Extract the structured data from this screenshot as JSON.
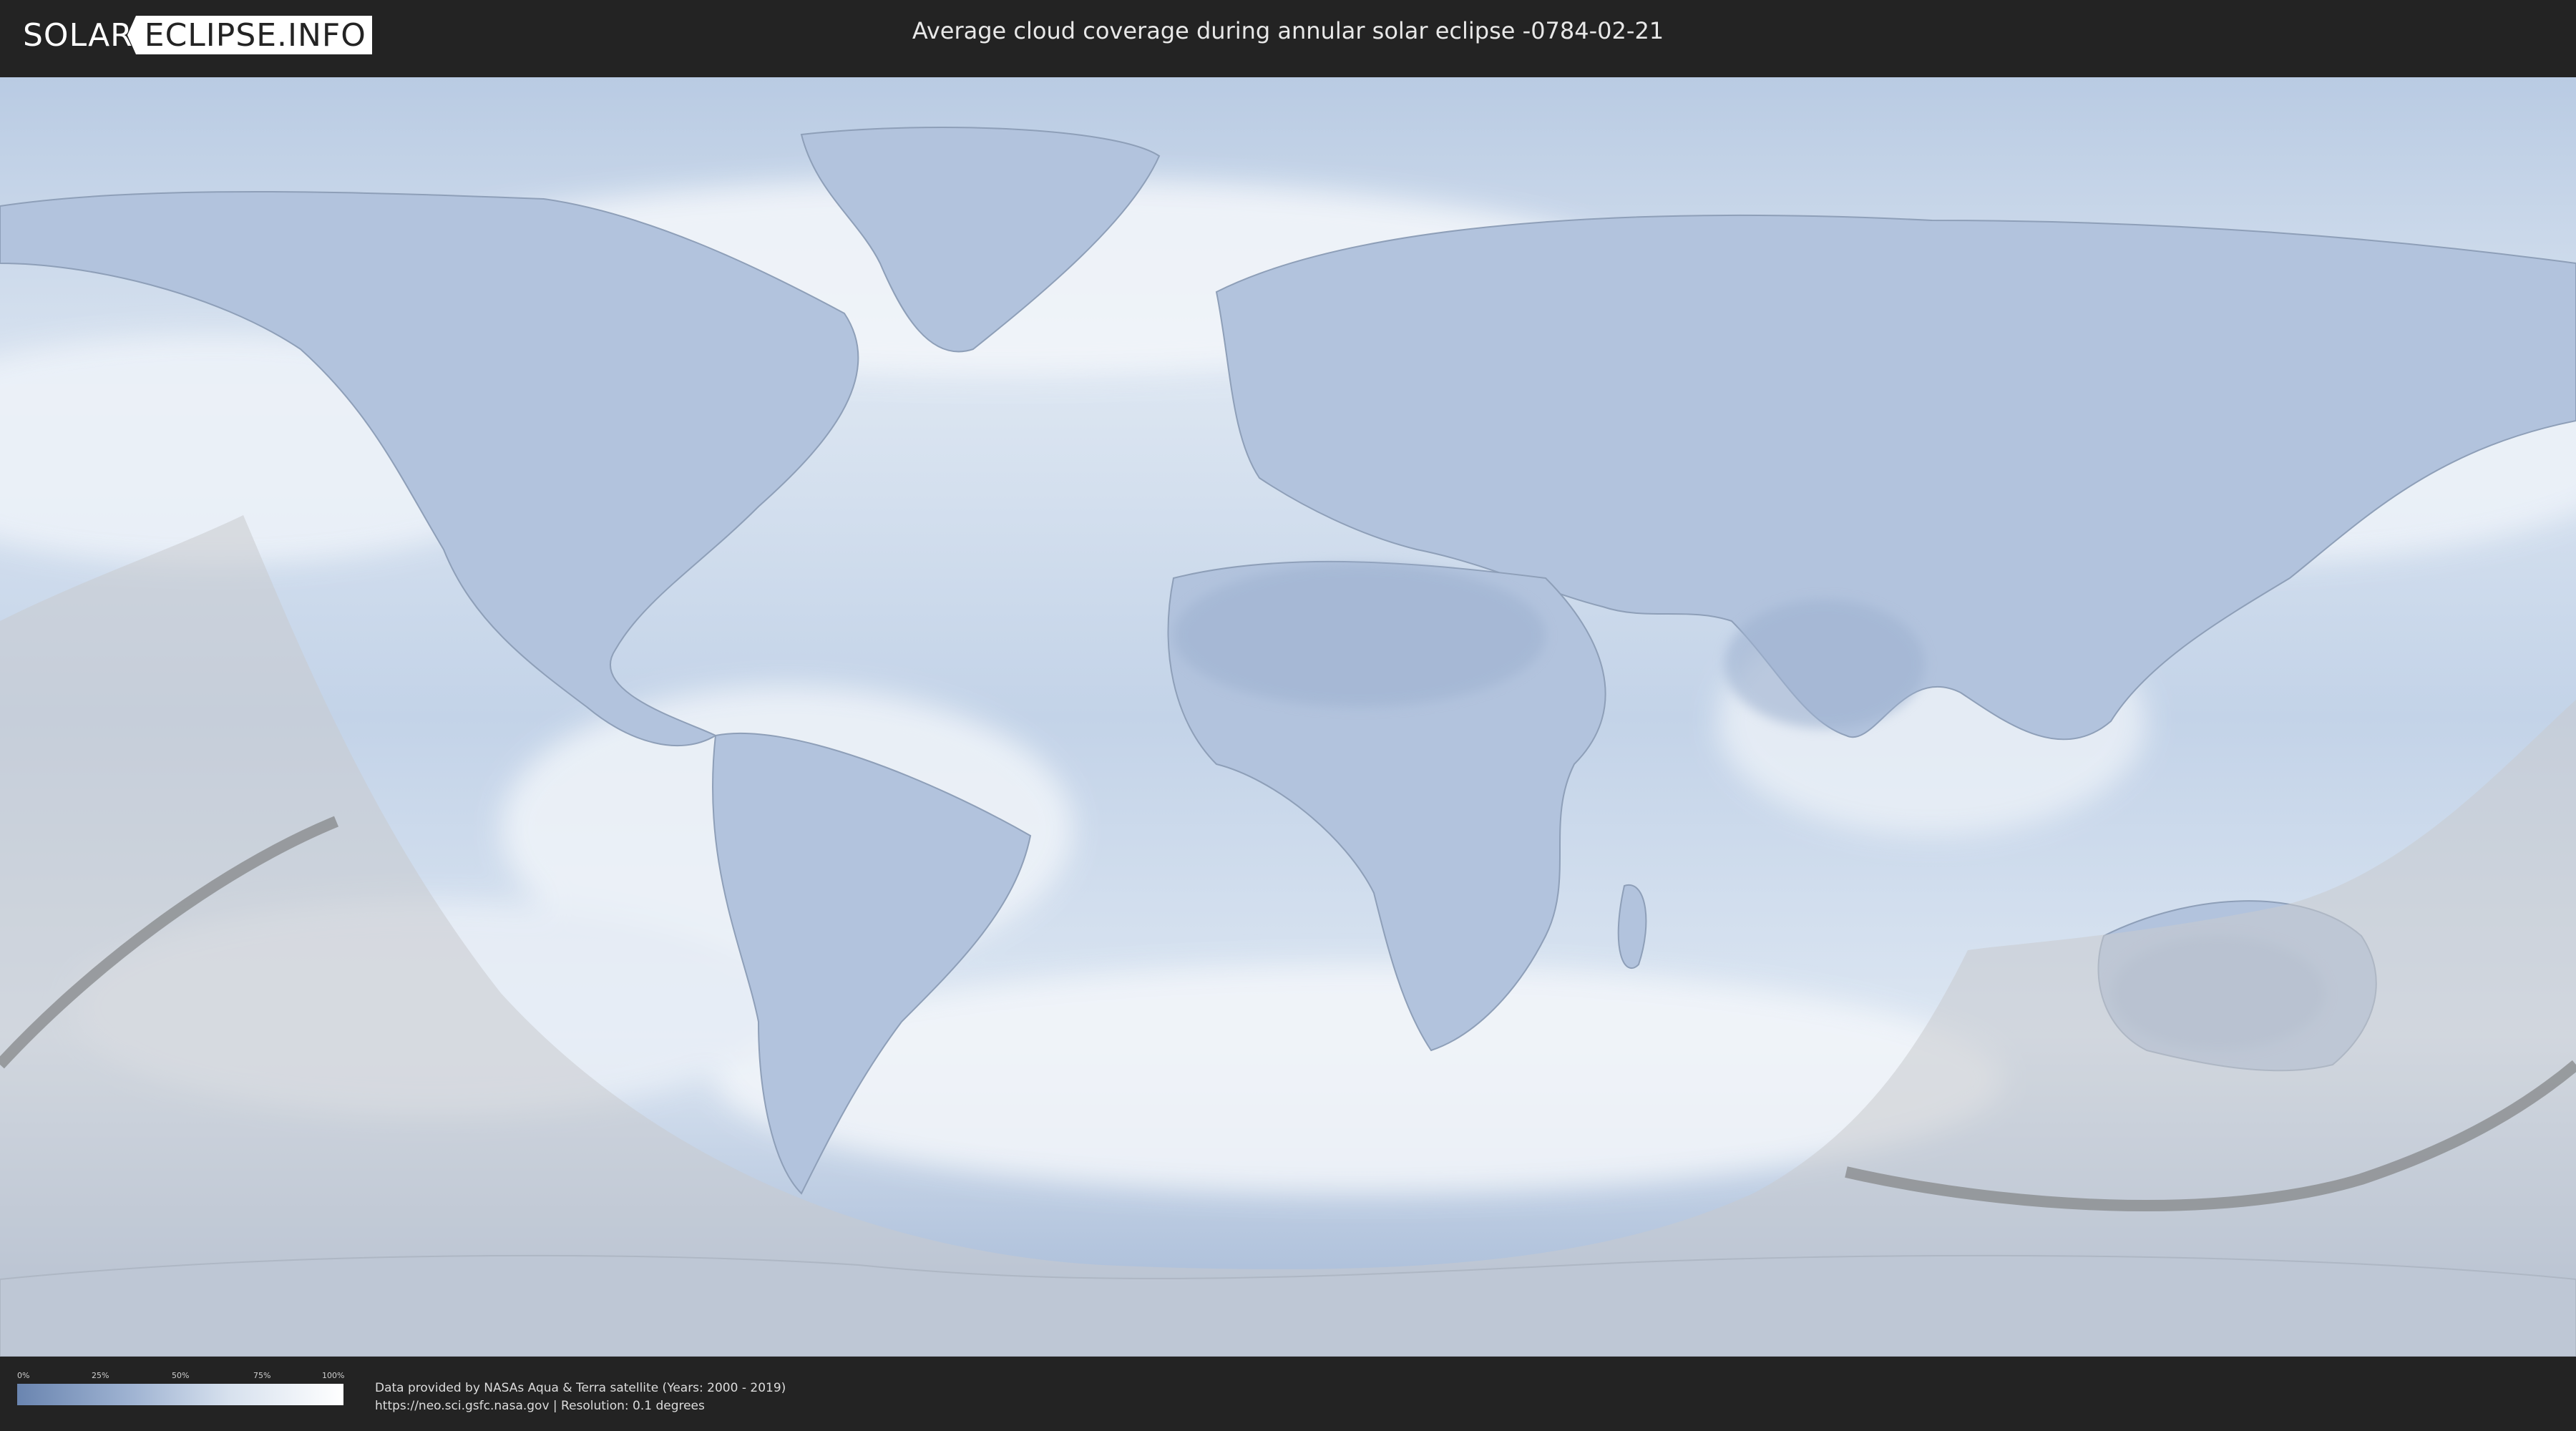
{
  "header": {
    "logo_left": "SOLAR",
    "logo_right": "ECLIPSE.INFO",
    "title": "Average cloud coverage during annular solar eclipse -0784-02-21"
  },
  "legend": {
    "ticks": [
      "0%",
      "25%",
      "50%",
      "75%",
      "100%"
    ],
    "colors": [
      "#6a85b0",
      "#9fb3d2",
      "#d7e1ee",
      "#ffffff"
    ]
  },
  "footer": {
    "credit_line1": "Data provided by NASAs Aqua & Terra satellite (Years: 2000 - 2019)",
    "credit_line2": "https://neo.sci.gsfc.nasa.gov | Resolution: 0.1 degrees"
  },
  "map": {
    "ocean_color": "#c6d4e8",
    "cloud_color": "#f2f5fa",
    "land_color": "#a9bcd8",
    "shadow_color": "#cfd2d6",
    "path_color": "#8a8c8f"
  }
}
